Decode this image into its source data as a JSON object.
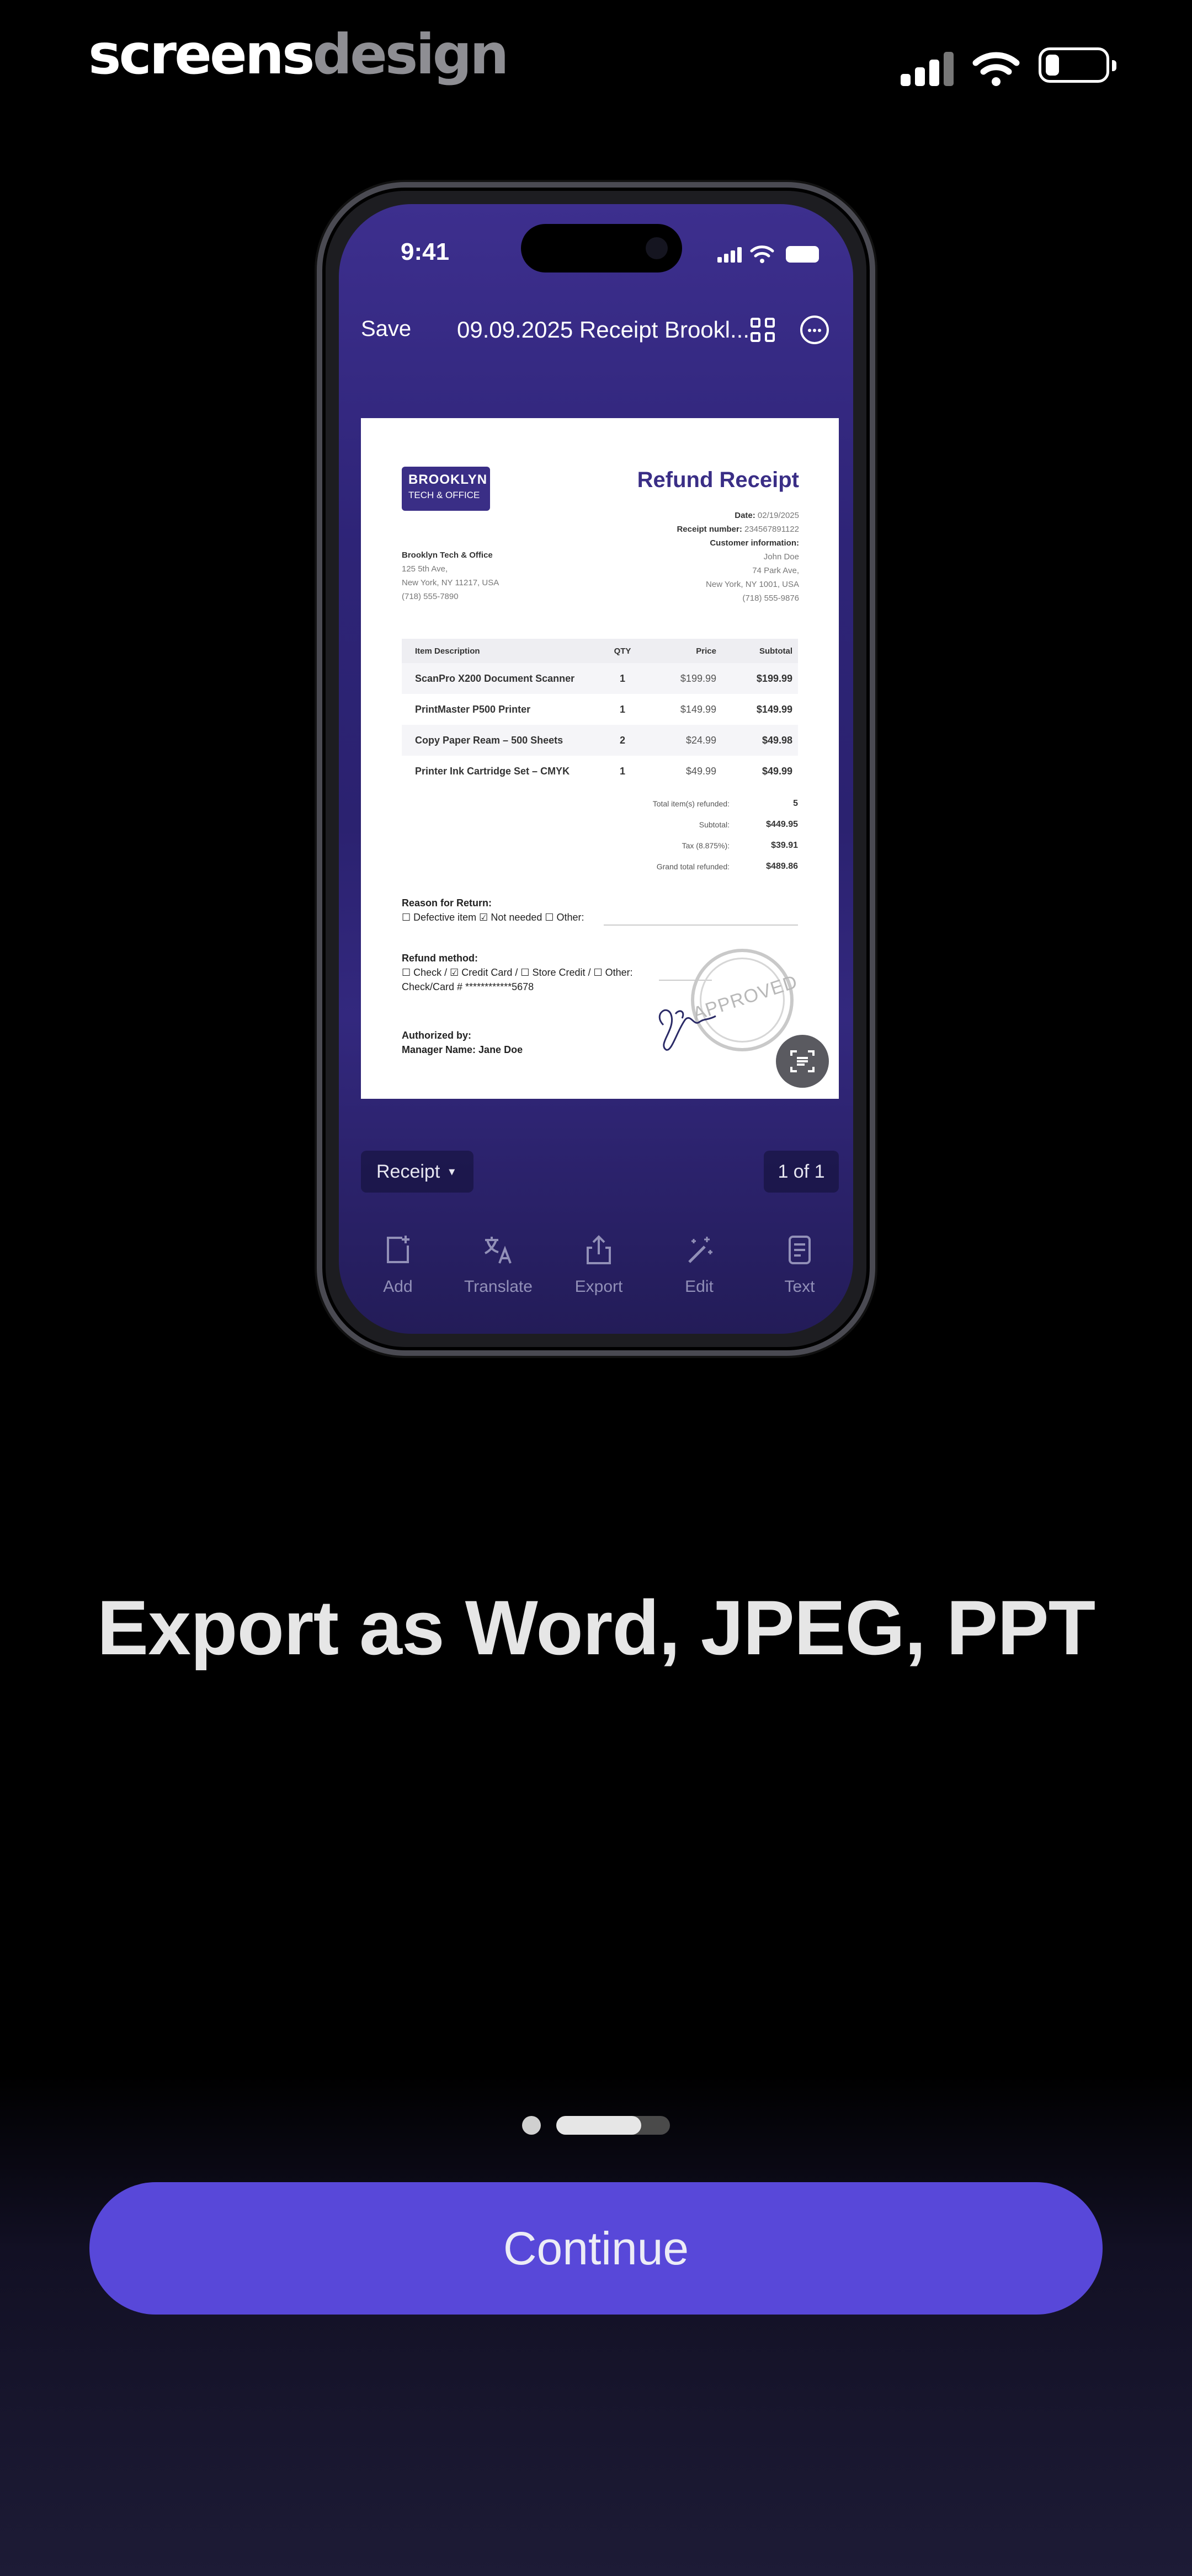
{
  "status_bar": {
    "brand_part1": "screens",
    "brand_part2": "design"
  },
  "phone": {
    "status": {
      "time": "9:41"
    },
    "nav": {
      "save_label": "Save",
      "title": "09.09.2025 Receipt Brookl..."
    },
    "document": {
      "logo_line1": "BROOKLYN",
      "logo_line2": "TECH & OFFICE",
      "title": "Refund Receipt",
      "date_label": "Date:",
      "date_value": "02/19/2025",
      "receipt_label": "Receipt number:",
      "receipt_value": "234567891122",
      "customer_label": "Customer information:",
      "customer_lines": [
        "John Doe",
        "74 Park Ave,",
        "New York, NY 1001, USA",
        "(718) 555-9876"
      ],
      "store_name": "Brooklyn Tech & Office",
      "store_lines": [
        "125 5th Ave,",
        "New York, NY 11217, USA",
        "(718) 555-7890"
      ],
      "table": {
        "headers": [
          "Item Description",
          "QTY",
          "Price",
          "Subtotal"
        ],
        "rows": [
          [
            "ScanPro X200 Document Scanner",
            "1",
            "$199.99",
            "$199.99"
          ],
          [
            "PrintMaster P500 Printer",
            "1",
            "$149.99",
            "$149.99"
          ],
          [
            "Copy Paper Ream – 500 Sheets",
            "2",
            "$24.99",
            "$49.98"
          ],
          [
            "Printer Ink Cartridge Set – CMYK",
            "1",
            "$49.99",
            "$49.99"
          ]
        ]
      },
      "totals": [
        {
          "label": "Total item(s) refunded:",
          "value": "5"
        },
        {
          "label": "Subtotal:",
          "value": "$449.95"
        },
        {
          "label": "Tax (8.875%):",
          "value": "$39.91"
        },
        {
          "label": "Grand total refunded:",
          "value": "$489.86"
        }
      ],
      "reason_title": "Reason for Return:",
      "reason_options": "☐ Defective item ☑ Not needed ☐ Other:",
      "method_title": "Refund method:",
      "method_options": "☐ Check / ☑ Credit Card / ☐ Store Credit / ☐ Other:",
      "card_line": "Check/Card # ************5678",
      "authorized_title": "Authorized by:",
      "manager_line": "Manager Name: Jane Doe",
      "stamp_text": "APPROVED"
    },
    "doc_type_label": "Receipt",
    "page_indicator": "1 of 1",
    "toolbar": [
      {
        "label": "Add",
        "icon": "add-page-icon"
      },
      {
        "label": "Translate",
        "icon": "translate-icon"
      },
      {
        "label": "Export",
        "icon": "share-icon"
      },
      {
        "label": "Edit",
        "icon": "magic-wand-icon"
      },
      {
        "label": "Text",
        "icon": "document-text-icon"
      }
    ]
  },
  "headline": "Export as Word, JPEG, PPT",
  "pagination": {
    "total": 3,
    "active": 2
  },
  "cta": {
    "label": "Continue"
  },
  "colors": {
    "accent": "#5848d9",
    "screen_bg": "#2e2477",
    "headline": "#e6e6e6"
  }
}
